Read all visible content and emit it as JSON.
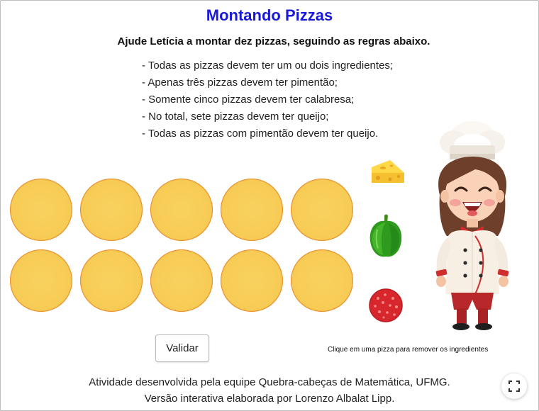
{
  "title": "Montando Pizzas",
  "subtitle": "Ajude Letícia a montar dez pizzas, seguindo as regras abaixo.",
  "rules": [
    "- Todas as pizzas devem ter um ou dois ingredientes;",
    "- Apenas três pizzas devem ter pimentão;",
    "- Somente cinco pizzas devem ter calabresa;",
    "- No total, sete pizzas devem ter queijo;",
    "- Todas as pizzas com pimentão devem ter queijo."
  ],
  "pizza_count": 10,
  "ingredients": [
    {
      "id": "cheese",
      "icon": "cheese-icon"
    },
    {
      "id": "pepper",
      "icon": "green-pepper-icon"
    },
    {
      "id": "pepperoni",
      "icon": "pepperoni-icon"
    }
  ],
  "validate_label": "Validar",
  "hint": "Clique em uma pizza para remover os ingredientes",
  "credits": [
    "Atividade desenvolvida pela equipe Quebra-cabeças de Matemática, UFMG.",
    "Versão interativa elaborada por Lorenzo Albalat Lipp."
  ],
  "colors": {
    "title": "#1a1ad6",
    "pizza_cheese": "#f7cc55",
    "pizza_crust": "#ec9a36"
  }
}
